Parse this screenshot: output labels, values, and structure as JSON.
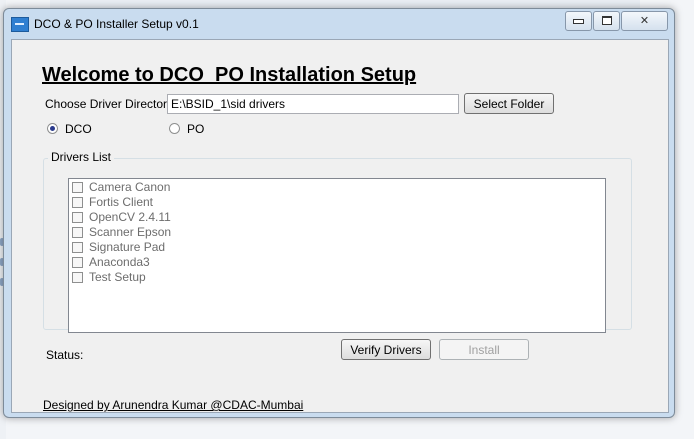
{
  "window": {
    "title": "DCO & PO Installer Setup v0.1"
  },
  "main": {
    "heading": "Welcome to DCO  PO Installation Setup",
    "directory_label": "Choose Driver Directory",
    "directory_value": "E:\\BSID_1\\sid drivers",
    "select_folder_label": "Select Folder",
    "mode_options": [
      {
        "label": "DCO",
        "selected": true
      },
      {
        "label": "PO",
        "selected": false
      }
    ],
    "drivers_list_title": "Drivers List",
    "drivers": [
      {
        "label": "Camera Canon",
        "checked": false
      },
      {
        "label": "Fortis Client",
        "checked": false
      },
      {
        "label": "OpenCV 2.4.11",
        "checked": false
      },
      {
        "label": "Scanner Epson",
        "checked": false
      },
      {
        "label": "Signature Pad",
        "checked": false
      },
      {
        "label": "Anaconda3",
        "checked": false
      },
      {
        "label": "Test Setup",
        "checked": false
      }
    ],
    "status_label": "Status:",
    "verify_label": "Verify Drivers",
    "install_label": "Install",
    "credit": "Designed by Arunendra Kumar @CDAC-Mumbai"
  }
}
